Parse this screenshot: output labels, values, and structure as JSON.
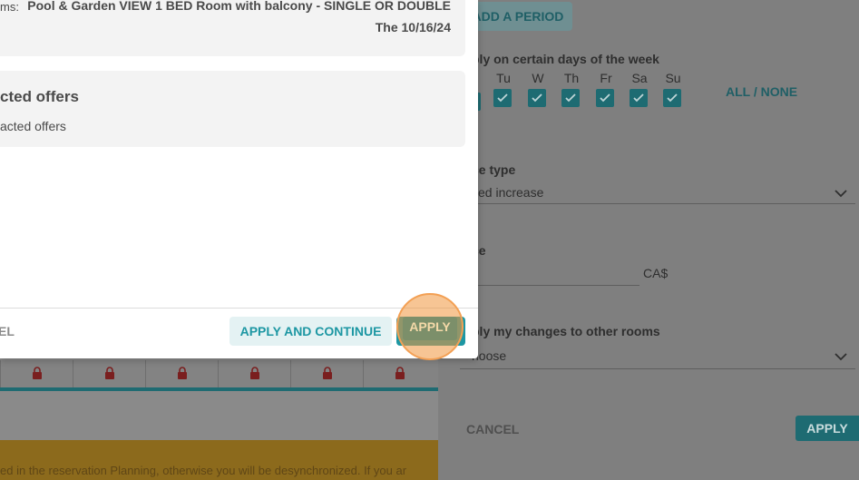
{
  "background": {
    "warning_text": "ed in the reservation Planning, otherwise you will be desynchronized. If you ar",
    "lock_icon": "lock-icon",
    "lock_color": "#7a1f1f"
  },
  "side_panel": {
    "add_period": "ADD A PERIOD",
    "days_title": "ply on certain days of the week",
    "days": [
      "Tu",
      "W",
      "Th",
      "Fr",
      "Sa",
      "Su"
    ],
    "all_none": "ALL / NONE",
    "price_type_label": "ce type",
    "price_type_value": "ked increase",
    "price_label": "ce",
    "price_unit": "CA$",
    "other_rooms_label": "ply my changes to other rooms",
    "other_rooms_value": "hoose",
    "cancel": "CANCEL",
    "apply": "APPLY"
  },
  "modal": {
    "rooms_label": "ms:",
    "room_name": "Pool & Garden VIEW 1 BED Room with balcony - SINGLE OR DOUBLE",
    "room_date": "The 10/16/24",
    "offers_title": "cted offers",
    "offers_sub": "acted offers",
    "cancel": "EL",
    "apply_continue": "APPLY AND CONTINUE",
    "apply": "APPLY"
  },
  "colors": {
    "accent": "#1d97a3",
    "highlight": "#f3a054"
  }
}
